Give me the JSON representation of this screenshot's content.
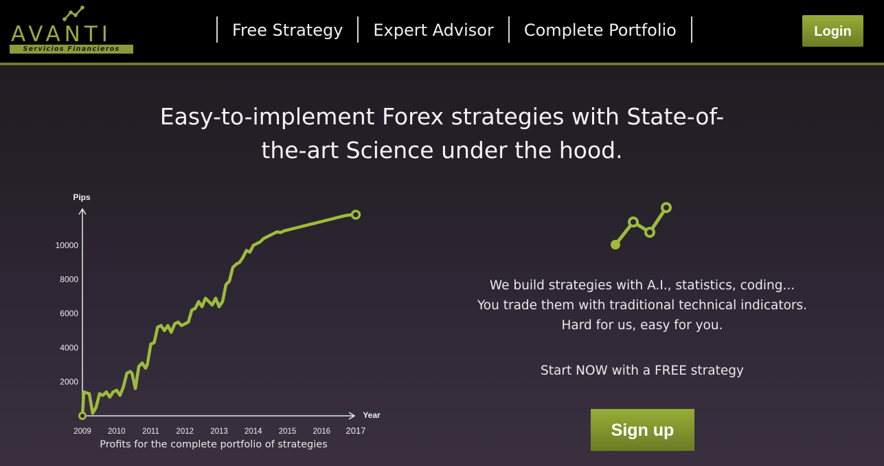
{
  "brand": {
    "name": "AVANTI",
    "tagline": "Servicios Financieros",
    "accent": "#9aad3c"
  },
  "nav": {
    "items": [
      "Free Strategy",
      "Expert Advisor",
      "Complete Portfolio"
    ],
    "login_label": "Login"
  },
  "hero": {
    "headline_line1": "Easy-to-implement Forex strategies with State-of-",
    "headline_line2": "the-art Science under the hood."
  },
  "pitch": {
    "line1": "We build strategies with A.I., statistics, coding...",
    "line2": "You trade them with traditional technical indicators.",
    "line3": "Hard for us, easy for you.",
    "cta_text": "Start NOW with a FREE strategy",
    "signup_label": "Sign up"
  },
  "chart_caption": "Profits for the complete portfolio of strategies",
  "icons": {
    "logo_mark": "rising-trend-icon",
    "pitch_mark": "rising-trend-icon"
  },
  "chart_data": {
    "type": "line",
    "xlabel": "Year",
    "ylabel": "Pips",
    "x_ticks": [
      "2009",
      "2010",
      "2011",
      "2012",
      "2013",
      "2014",
      "2015",
      "2016",
      "2017"
    ],
    "y_ticks": [
      "2000",
      "4000",
      "6000",
      "8000",
      "10000"
    ],
    "xlim": [
      2009,
      2017
    ],
    "ylim": [
      0,
      11800
    ],
    "grid": false,
    "series_color": "#9dbc3b",
    "x": [
      2009.0,
      2009.04,
      2009.2,
      2009.3,
      2009.4,
      2009.5,
      2009.6,
      2009.7,
      2009.8,
      2009.9,
      2010.0,
      2010.1,
      2010.2,
      2010.3,
      2010.4,
      2010.45,
      2010.55,
      2010.65,
      2010.75,
      2010.85,
      2010.9,
      2011.0,
      2011.1,
      2011.2,
      2011.3,
      2011.4,
      2011.5,
      2011.6,
      2011.7,
      2011.8,
      2011.9,
      2012.0,
      2012.1,
      2012.2,
      2012.3,
      2012.4,
      2012.5,
      2012.6,
      2012.7,
      2012.8,
      2012.9,
      2013.0,
      2013.1,
      2013.2,
      2013.3,
      2013.4,
      2013.5,
      2013.6,
      2013.7,
      2013.8,
      2013.9,
      2014.0,
      2014.1,
      2014.2,
      2014.3,
      2014.4,
      2014.5,
      2014.6,
      2014.7,
      2014.8,
      2014.9,
      2015.0,
      2015.1,
      2015.2,
      2015.3,
      2015.4,
      2015.5,
      2015.6,
      2015.7,
      2015.8,
      2015.9,
      2016.0,
      2016.1,
      2016.2,
      2016.3,
      2016.4,
      2016.5,
      2016.6,
      2016.7,
      2016.8,
      2016.9,
      2017.0
    ],
    "y": [
      0,
      1400,
      1300,
      150,
      500,
      1300,
      1200,
      1400,
      1100,
      1400,
      1500,
      1200,
      1700,
      2500,
      2600,
      2500,
      1600,
      2900,
      3100,
      2800,
      3000,
      4200,
      4300,
      5200,
      5300,
      5000,
      5300,
      4900,
      5400,
      5500,
      5300,
      5400,
      5500,
      6200,
      6300,
      6700,
      6400,
      6900,
      6700,
      6500,
      6900,
      6400,
      6700,
      7700,
      7900,
      8700,
      8900,
      9000,
      9300,
      9700,
      9600,
      10000,
      10100,
      10200,
      10400,
      10500,
      10600,
      10700,
      10800,
      10750,
      10850,
      10900,
      10950,
      11000,
      11050,
      11100,
      11150,
      11200,
      11250,
      11300,
      11350,
      11400,
      11450,
      11500,
      11550,
      11600,
      11650,
      11700,
      11750,
      11780,
      11800,
      11800
    ]
  }
}
